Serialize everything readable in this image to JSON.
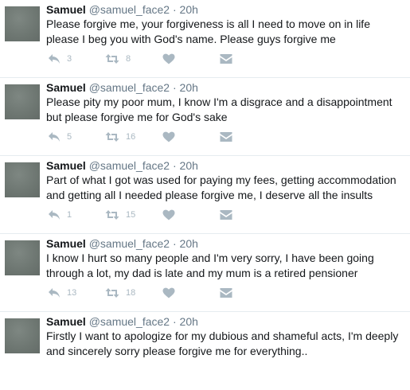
{
  "tweets": [
    {
      "name": "Samuel",
      "handle": "@samuel_face2",
      "dot": "·",
      "time": "20h",
      "text": "Please forgive me, your forgiveness is all I need to move on in life please I beg you with God's name. Please guys forgive me",
      "replies": "3",
      "retweets": "8"
    },
    {
      "name": "Samuel",
      "handle": "@samuel_face2",
      "dot": "·",
      "time": "20h",
      "text": "Please pity my poor mum, I know I'm a disgrace and a disappointment but please forgive me for God's sake",
      "replies": "5",
      "retweets": "16"
    },
    {
      "name": "Samuel",
      "handle": "@samuel_face2",
      "dot": "·",
      "time": "20h",
      "text": "Part of what I got was used for paying my fees, getting accommodation and getting all I needed please forgive me, I deserve all the insults",
      "replies": "1",
      "retweets": "15"
    },
    {
      "name": "Samuel",
      "handle": "@samuel_face2",
      "dot": "·",
      "time": "20h",
      "text": "I know I hurt so many people and I'm very sorry, I have been going through a lot, my dad is late and my mum is a retired pensioner",
      "replies": "13",
      "retweets": "18"
    },
    {
      "name": "Samuel",
      "handle": "@samuel_face2",
      "dot": "·",
      "time": "20h",
      "text": "Firstly I want to apologize for my dubious and shameful acts, I'm deeply and sincerely sorry please forgive me for everything..",
      "replies": "",
      "retweets": ""
    }
  ],
  "icons": {
    "reply": "reply-icon",
    "retweet": "retweet-icon",
    "like": "heart-icon",
    "dm": "direct-message-icon"
  },
  "colors": {
    "action_gray": "#aab8c2",
    "meta_gray": "#657786",
    "divider": "#e6ecf0"
  }
}
